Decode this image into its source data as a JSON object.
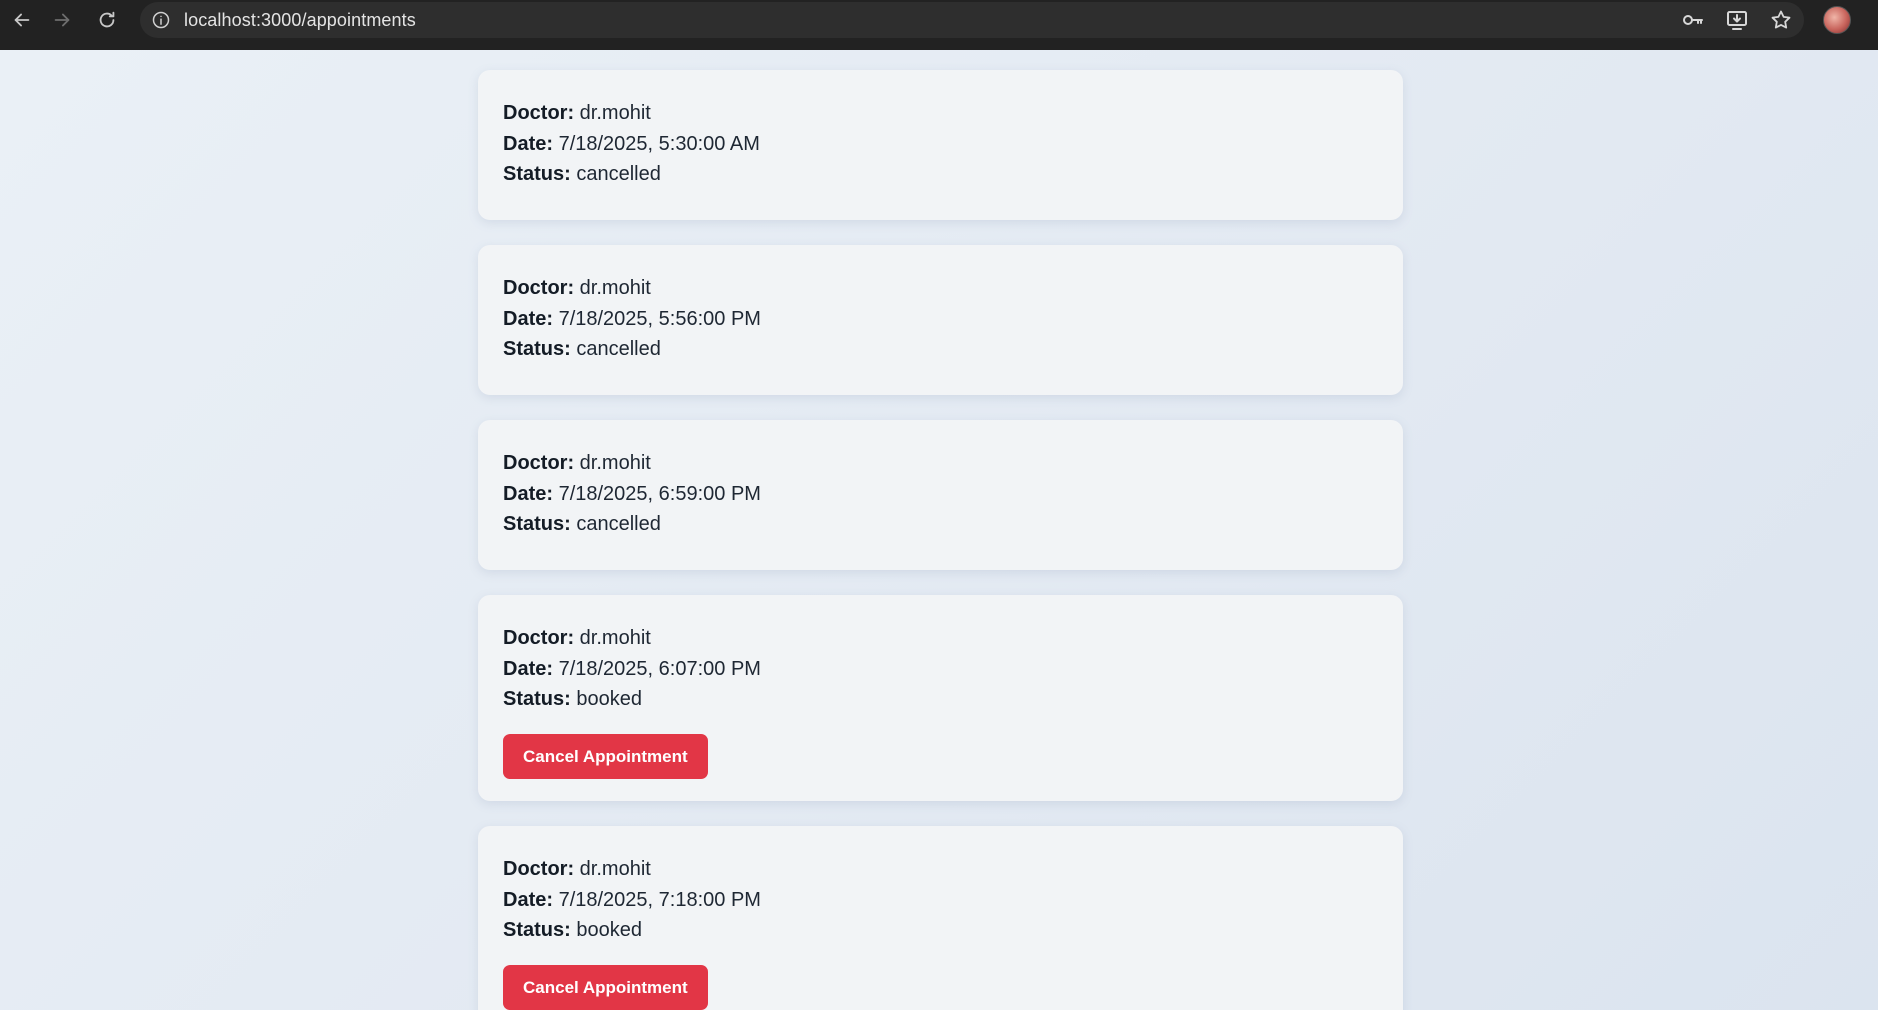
{
  "browser": {
    "url": "localhost:3000/appointments",
    "nav_icons": [
      "back-arrow-icon",
      "forward-arrow-icon",
      "reload-icon"
    ],
    "toolbar_icons": [
      "password-key-icon",
      "install-app-icon",
      "bookmark-star-icon"
    ]
  },
  "labels": {
    "doctor": "Doctor:",
    "date": "Date:",
    "status": "Status:",
    "cancel": "Cancel Appointment"
  },
  "appointments": [
    {
      "doctor": "dr.mohit",
      "date": "7/18/2025, 5:30:00 AM",
      "status": "cancelled"
    },
    {
      "doctor": "dr.mohit",
      "date": "7/18/2025, 5:56:00 PM",
      "status": "cancelled"
    },
    {
      "doctor": "dr.mohit",
      "date": "7/18/2025, 6:59:00 PM",
      "status": "cancelled"
    },
    {
      "doctor": "dr.mohit",
      "date": "7/18/2025, 6:07:00 PM",
      "status": "booked"
    },
    {
      "doctor": "dr.mohit",
      "date": "7/18/2025, 7:18:00 PM",
      "status": "booked"
    }
  ],
  "colors": {
    "cancel_button": "#e23646",
    "card_background": "#f2f4f6",
    "page_background": "#e6edf5"
  }
}
